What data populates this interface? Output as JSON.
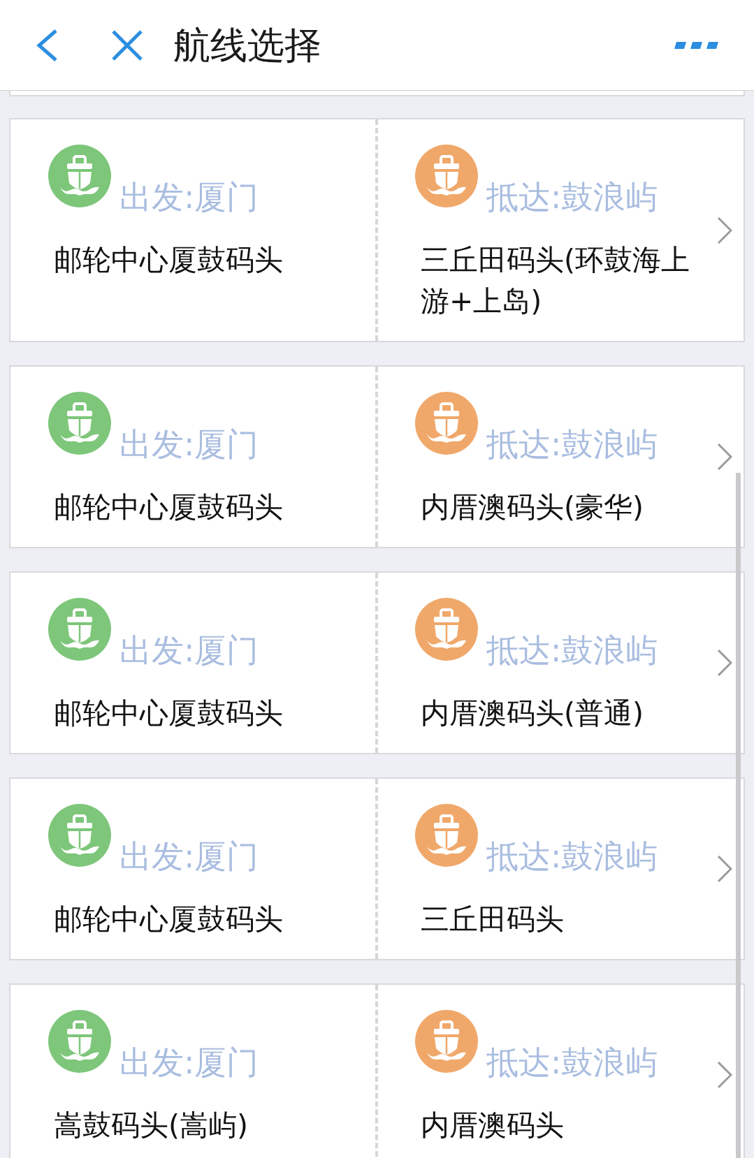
{
  "header": {
    "title": "航线选择"
  },
  "routes": [
    {
      "departure": {
        "label": "出发:厦门",
        "pier": "邮轮中心厦鼓码头"
      },
      "arrival": {
        "label": "抵达:鼓浪屿",
        "pier": "三丘田码头(环鼓海上游+上岛)"
      }
    },
    {
      "departure": {
        "label": "出发:厦门",
        "pier": "邮轮中心厦鼓码头"
      },
      "arrival": {
        "label": "抵达:鼓浪屿",
        "pier": "内厝澳码头(豪华)"
      }
    },
    {
      "departure": {
        "label": "出发:厦门",
        "pier": "邮轮中心厦鼓码头"
      },
      "arrival": {
        "label": "抵达:鼓浪屿",
        "pier": "内厝澳码头(普通)"
      }
    },
    {
      "departure": {
        "label": "出发:厦门",
        "pier": "邮轮中心厦鼓码头"
      },
      "arrival": {
        "label": "抵达:鼓浪屿",
        "pier": "三丘田码头"
      }
    },
    {
      "departure": {
        "label": "出发:厦门",
        "pier": "嵩鼓码头(嵩屿)"
      },
      "arrival": {
        "label": "抵达:鼓浪屿",
        "pier": "内厝澳码头"
      }
    }
  ]
}
